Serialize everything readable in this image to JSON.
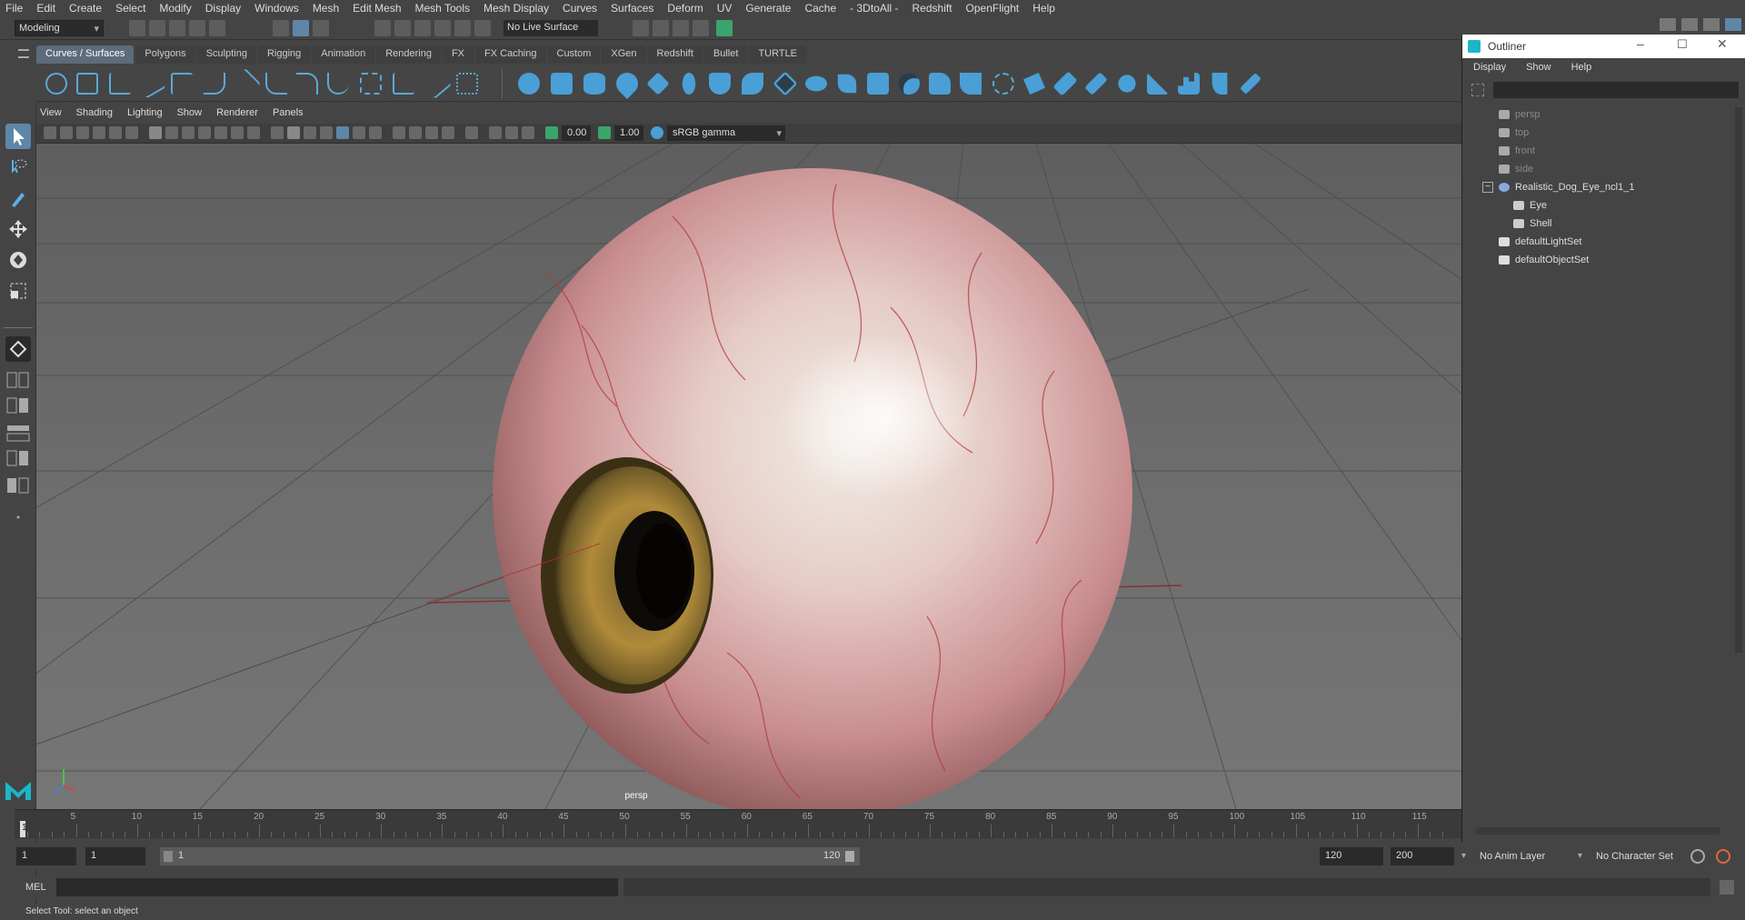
{
  "menubar": [
    "File",
    "Edit",
    "Create",
    "Select",
    "Modify",
    "Display",
    "Windows",
    "Mesh",
    "Edit Mesh",
    "Mesh Tools",
    "Mesh Display",
    "Curves",
    "Surfaces",
    "Deform",
    "UV",
    "Generate",
    "Cache",
    "- 3DtoAll -",
    "Redshift",
    "OpenFlight",
    "Help"
  ],
  "workspace": "Modeling",
  "live_surface": "No Live Surface",
  "shelf_tabs": [
    "Curves / Surfaces",
    "Polygons",
    "Sculpting",
    "Rigging",
    "Animation",
    "Rendering",
    "FX",
    "FX Caching",
    "Custom",
    "XGen",
    "Redshift",
    "Bullet",
    "TURTLE"
  ],
  "panel_menu": [
    "View",
    "Shading",
    "Lighting",
    "Show",
    "Renderer",
    "Panels"
  ],
  "panel": {
    "exposure": "0.00",
    "gamma": "1.00",
    "colorspace": "sRGB gamma"
  },
  "viewport": {
    "camera_label": "persp"
  },
  "outliner": {
    "title": "Outliner",
    "menu": [
      "Display",
      "Show",
      "Help"
    ],
    "items": [
      {
        "label": "persp",
        "dim": true
      },
      {
        "label": "top",
        "dim": true
      },
      {
        "label": "front",
        "dim": true
      },
      {
        "label": "side",
        "dim": true
      },
      {
        "label": "Realistic_Dog_Eye_ncl1_1",
        "dim": false
      },
      {
        "label": "Eye",
        "dim": false
      },
      {
        "label": "Shell",
        "dim": false
      },
      {
        "label": "defaultLightSet",
        "dim": false
      },
      {
        "label": "defaultObjectSet",
        "dim": false
      }
    ]
  },
  "timeline": {
    "current": "1",
    "ticks": [
      "5",
      "10",
      "15",
      "20",
      "25",
      "30",
      "35",
      "40",
      "45",
      "50",
      "55",
      "60",
      "65",
      "70",
      "75",
      "80",
      "85",
      "90",
      "95",
      "100",
      "105",
      "110",
      "115"
    ]
  },
  "range": {
    "start": "1",
    "start2": "1",
    "slider_start": "1",
    "slider_end": "120",
    "end": "120",
    "end2": "200",
    "anim_layer": "No Anim Layer",
    "char_set": "No Character Set"
  },
  "mel_label": "MEL",
  "status_text": "Select Tool: select an object"
}
